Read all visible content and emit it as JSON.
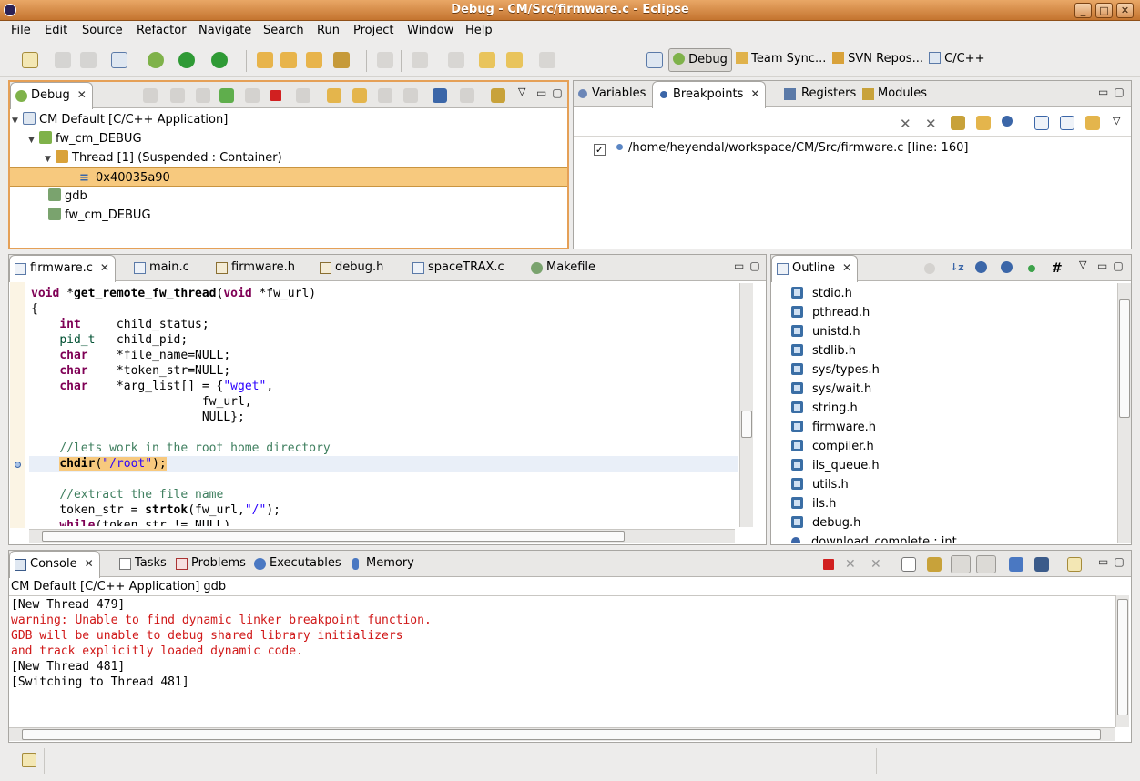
{
  "window": {
    "title": "Debug - CM/Src/firmware.c - Eclipse"
  },
  "menu": [
    "File",
    "Edit",
    "Source",
    "Refactor",
    "Navigate",
    "Search",
    "Run",
    "Project",
    "Window",
    "Help"
  ],
  "perspectives": {
    "debug": "Debug",
    "team_sync": "Team Sync...",
    "svn": "SVN Repos...",
    "cpp": "C/C++"
  },
  "debug_view": {
    "tab": "Debug",
    "tree": [
      "CM Default [C/C++ Application]",
      "fw_cm_DEBUG",
      "Thread [1] (Suspended : Container)",
      "0x40035a90",
      "gdb",
      "fw_cm_DEBUG"
    ]
  },
  "right_top": {
    "tabs": [
      "Variables",
      "Breakpoints",
      "Registers",
      "Modules"
    ],
    "breakpoint": "/home/heyendal/workspace/CM/Src/firmware.c [line: 160]"
  },
  "editor": {
    "tabs": [
      "firmware.c",
      "main.c",
      "firmware.h",
      "debug.h",
      "spaceTRAX.c",
      "Makefile"
    ],
    "current_line": "    chdir(\"/root\");"
  },
  "outline": {
    "tab": "Outline",
    "items": [
      "stdio.h",
      "pthread.h",
      "unistd.h",
      "stdlib.h",
      "sys/types.h",
      "sys/wait.h",
      "string.h",
      "firmware.h",
      "compiler.h",
      "ils_queue.h",
      "utils.h",
      "ils.h",
      "debug.h",
      "download_complete : int"
    ]
  },
  "console": {
    "tabs": [
      "Console",
      "Tasks",
      "Problems",
      "Executables",
      "Memory"
    ],
    "header": "CM Default [C/C++ Application] gdb",
    "lines": [
      "[New Thread 479]",
      "warning: Unable to find dynamic linker breakpoint function.",
      "GDB will be unable to debug shared library initializers",
      "and track explicitly loaded dynamic code.",
      "[New Thread 481]",
      "[Switching to Thread 481]"
    ]
  },
  "colors": {
    "titlebar": "#d98a45",
    "selection": "#f7c97e",
    "current_line": "#e9eff8",
    "keyword": "#7f0055",
    "comment": "#3f7f5f",
    "error": "#d01818"
  }
}
